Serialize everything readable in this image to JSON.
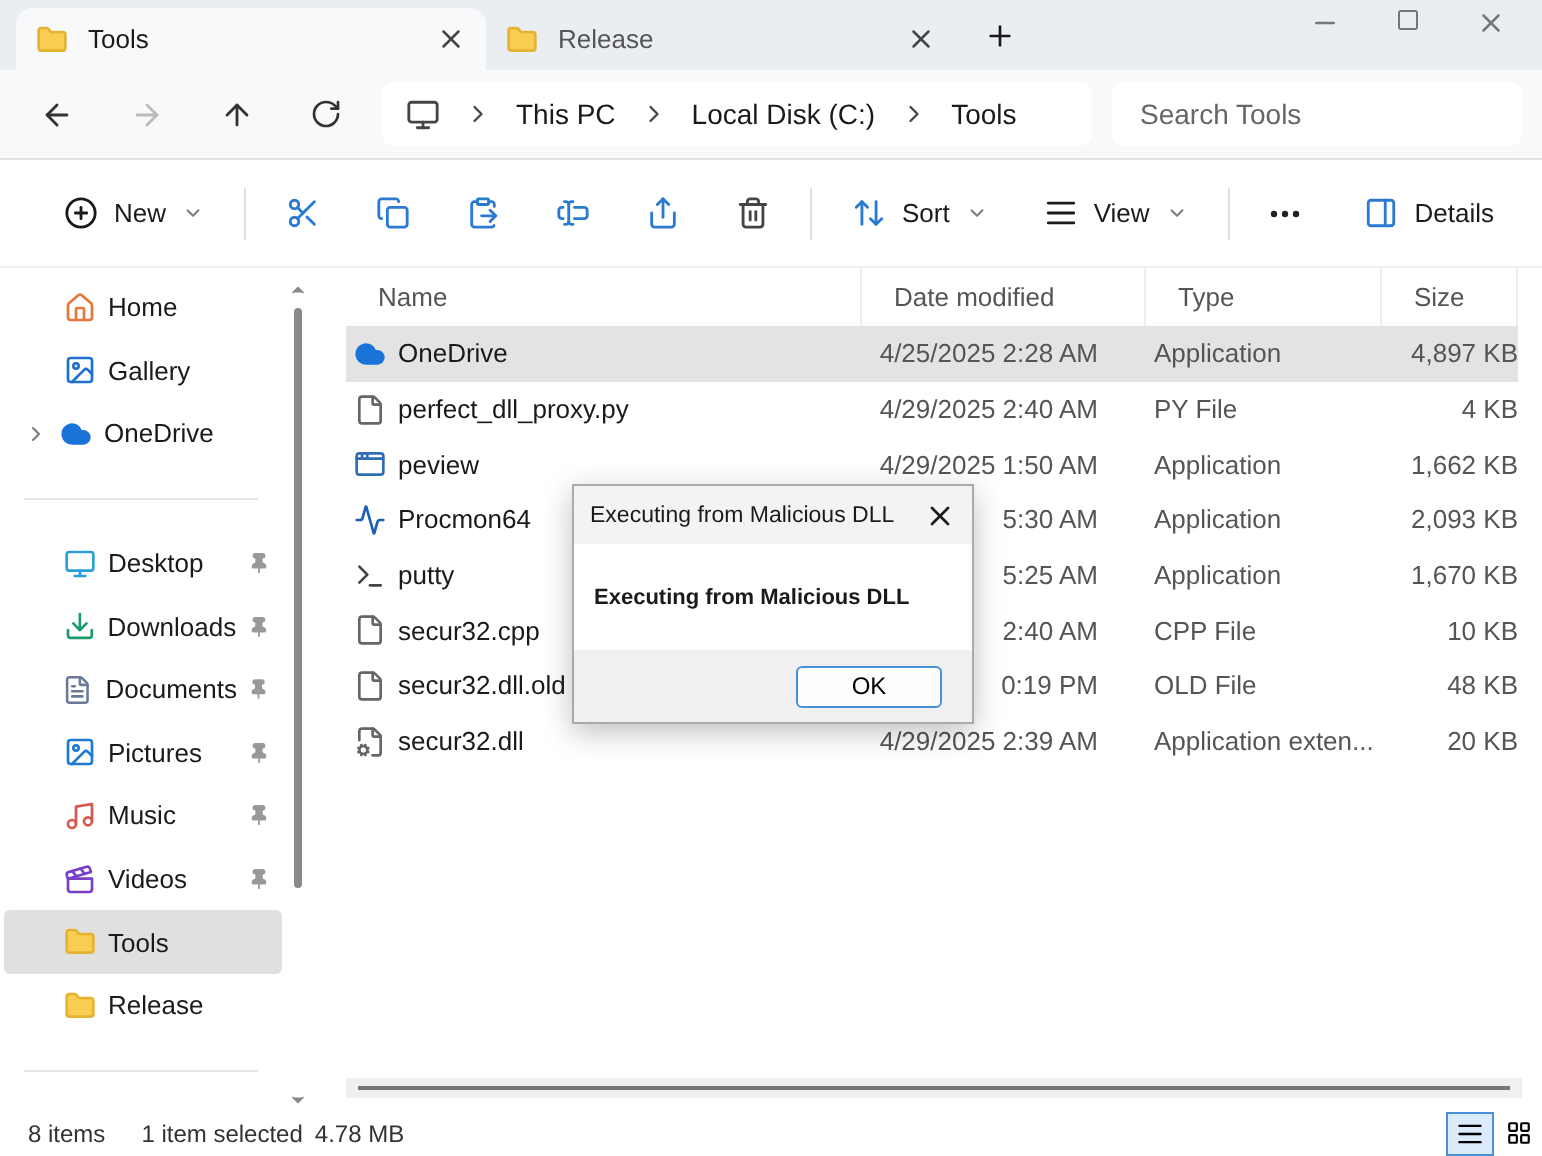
{
  "tabs": [
    {
      "label": "Tools",
      "selected": true
    },
    {
      "label": "Release",
      "selected": false
    }
  ],
  "address": {
    "crumbs": [
      "This PC",
      "Local Disk (C:)",
      "Tools"
    ],
    "search": {
      "placeholder": "Search Tools"
    }
  },
  "toolbar": {
    "new": "New",
    "sort": "Sort",
    "view": "View",
    "details": "Details"
  },
  "sidebar": {
    "groups": [
      [
        {
          "label": "Home",
          "kind": "home",
          "selected": false
        },
        {
          "label": "Gallery",
          "kind": "gallery",
          "selected": false
        },
        {
          "label": "OneDrive",
          "kind": "cloud",
          "selected": false,
          "expanded": false
        }
      ],
      [
        {
          "label": "Desktop",
          "kind": "desktop",
          "selected": false,
          "pinned": true
        },
        {
          "label": "Downloads",
          "kind": "download",
          "selected": false,
          "pinned": true
        },
        {
          "label": "Documents",
          "kind": "document",
          "selected": false,
          "pinned": true
        },
        {
          "label": "Pictures",
          "kind": "picture",
          "selected": false,
          "pinned": true
        },
        {
          "label": "Music",
          "kind": "music",
          "selected": false,
          "pinned": true
        },
        {
          "label": "Videos",
          "kind": "video",
          "selected": false,
          "pinned": true
        },
        {
          "label": "Tools",
          "kind": "folder",
          "selected": true
        },
        {
          "label": "Release",
          "kind": "folder",
          "selected": false
        }
      ]
    ]
  },
  "table": {
    "columns": [
      "Name",
      "Date modified",
      "Type",
      "Size"
    ],
    "rows": [
      {
        "name": "OneDrive",
        "kind": "cloud",
        "date": "4/25/2025 2:28 AM",
        "type": "Application",
        "size": "4,897 KB",
        "selected": true
      },
      {
        "name": "perfect_dll_proxy.py",
        "kind": "file",
        "date": "4/29/2025 2:40 AM",
        "type": "PY File",
        "size": "4 KB",
        "selected": false
      },
      {
        "name": "peview",
        "kind": "app",
        "date": "4/29/2025 1:50 AM",
        "type": "Application",
        "size": "1,662 KB",
        "selected": false
      },
      {
        "name": "Procmon64",
        "kind": "monitor",
        "date": "5:30 AM",
        "type": "Application",
        "size": "2,093 KB",
        "selected": false
      },
      {
        "name": "putty",
        "kind": "terminal",
        "date": "5:25 AM",
        "type": "Application",
        "size": "1,670 KB",
        "selected": false
      },
      {
        "name": "secur32.cpp",
        "kind": "file",
        "date": "2:40 AM",
        "type": "CPP File",
        "size": "10 KB",
        "selected": false
      },
      {
        "name": "secur32.dll.old",
        "kind": "file",
        "date": "0:19 PM",
        "type": "OLD File",
        "size": "48 KB",
        "selected": false
      },
      {
        "name": "secur32.dll",
        "kind": "dll",
        "date": "4/29/2025 2:39 AM",
        "type": "Application exten...",
        "size": "20 KB",
        "selected": false
      }
    ]
  },
  "dialog": {
    "title": "Executing from Malicious DLL",
    "message": "Executing from Malicious DLL",
    "button": "OK"
  },
  "status_bar": {
    "count": "8 items",
    "selection": "1 item selected",
    "size": "4.78 MB",
    "views": [
      {
        "kind": "details",
        "selected": true
      },
      {
        "kind": "tiles",
        "selected": false
      }
    ]
  }
}
